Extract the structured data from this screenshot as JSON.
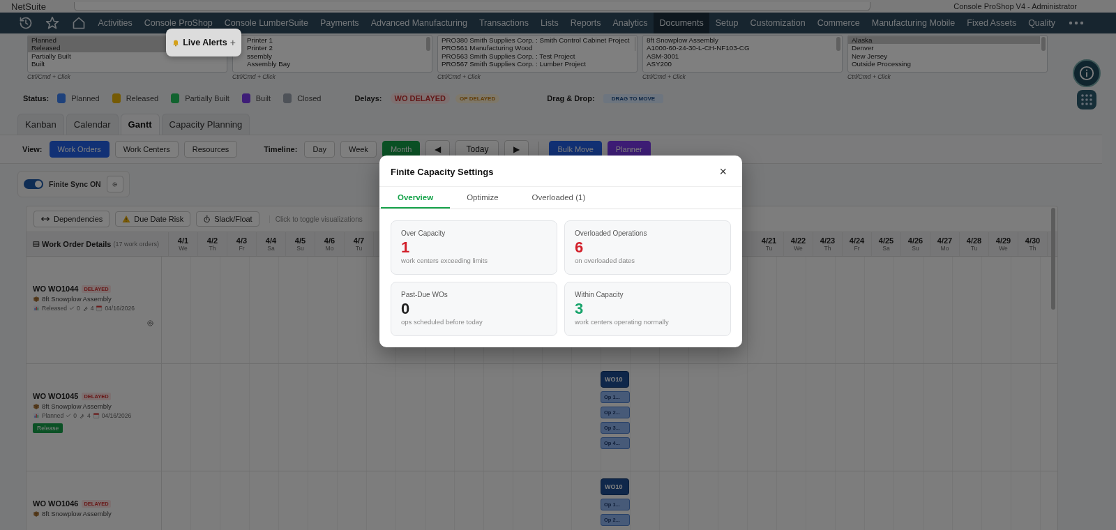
{
  "header": {
    "brand": "NetSuite",
    "user": "Console ProShop V4 - Administrator"
  },
  "nav": {
    "items": [
      {
        "label": "Activities",
        "selected": false
      },
      {
        "label": "Console ProShop",
        "selected": false
      },
      {
        "label": "Console LumberSuite",
        "selected": false
      },
      {
        "label": "Payments",
        "selected": false
      },
      {
        "label": "Advanced Manufacturing",
        "selected": false
      },
      {
        "label": "Transactions",
        "selected": false
      },
      {
        "label": "Lists",
        "selected": false
      },
      {
        "label": "Reports",
        "selected": false
      },
      {
        "label": "Analytics",
        "selected": false
      },
      {
        "label": "Documents",
        "selected": true
      },
      {
        "label": "Setup",
        "selected": false
      },
      {
        "label": "Customization",
        "selected": false
      },
      {
        "label": "Commerce",
        "selected": false
      },
      {
        "label": "Manufacturing Mobile",
        "selected": false
      },
      {
        "label": "Fixed Assets",
        "selected": false
      },
      {
        "label": "Quality",
        "selected": false
      }
    ]
  },
  "filters": [
    {
      "hint": "Ctrl/Cmd + Click",
      "options": [
        {
          "label": "Planned",
          "selected": true
        },
        {
          "label": "Released",
          "selected": true
        },
        {
          "label": "Partially Built",
          "selected": false
        },
        {
          "label": "Built",
          "selected": false
        }
      ]
    },
    {
      "hint": "Ctrl/Cmd + Click",
      "options": [
        {
          "label": "Printer 1",
          "selected": false
        },
        {
          "label": "Printer 2",
          "selected": false
        },
        {
          "label": "ssembly",
          "selected": false
        },
        {
          "label": "Assembly Bay",
          "selected": false
        }
      ]
    },
    {
      "hint": "Ctrl/Cmd + Click",
      "options": [
        {
          "label": "PRO380 Smith Supplies Corp. : Smith Control Cabinet Project",
          "selected": false
        },
        {
          "label": "PRO561 Manufacturing Wood",
          "selected": false
        },
        {
          "label": "PRO563 Smith Supplies Corp. : Test Project",
          "selected": false
        },
        {
          "label": "PRO567 Smith Supplies Corp. : Lumber Project",
          "selected": false
        }
      ]
    },
    {
      "hint": "Ctrl/Cmd + Click",
      "options": [
        {
          "label": "8ft Snowplow Assembly",
          "selected": false
        },
        {
          "label": "A1000-60-24-30-L-CH-NF103-CG",
          "selected": false
        },
        {
          "label": "ASM-3001",
          "selected": false
        },
        {
          "label": "ASY200",
          "selected": false
        }
      ]
    },
    {
      "hint": "Ctrl/Cmd + Click",
      "options": [
        {
          "label": "Alaska",
          "selected": true
        },
        {
          "label": "Denver",
          "selected": false
        },
        {
          "label": "New Jersey",
          "selected": false
        },
        {
          "label": "Outside Processing",
          "selected": false
        }
      ]
    }
  ],
  "legend": {
    "status_label": "Status:",
    "statuses": [
      {
        "label": "Planned",
        "color": "#1e417b"
      },
      {
        "label": "Released",
        "color": "#755a04"
      },
      {
        "label": "Partially Built",
        "color": "#11632f"
      },
      {
        "label": "Built",
        "color": "#3e1d77"
      },
      {
        "label": "Closed",
        "color": "#4e5258"
      }
    ],
    "delays_label": "Delays:",
    "delays": [
      {
        "label": "WO DELAYED",
        "kind": "wo"
      },
      {
        "label": "OP DELAYED",
        "kind": "op"
      }
    ],
    "drag_label": "Drag & Drop:",
    "drag_badge": "DRAG TO MOVE"
  },
  "tabs": [
    {
      "label": "Kanban",
      "selected": false
    },
    {
      "label": "Calendar",
      "selected": false
    },
    {
      "label": "Gantt",
      "selected": true
    },
    {
      "label": "Capacity Planning",
      "selected": false
    }
  ],
  "view": {
    "label": "View:",
    "options": [
      {
        "label": "Work Orders",
        "selected": true
      },
      {
        "label": "Work Centers",
        "selected": false
      },
      {
        "label": "Resources",
        "selected": false
      }
    ]
  },
  "timeline": {
    "label": "Timeline:",
    "options": [
      {
        "label": "Day",
        "selected": false
      },
      {
        "label": "Week",
        "selected": false
      },
      {
        "label": "Month",
        "selected": true
      }
    ],
    "prev": "◀",
    "today": "Today",
    "next": "▶"
  },
  "actions": [
    {
      "label": "Bulk Move",
      "kind": "bulk"
    },
    {
      "label": "Planner",
      "kind": "planner"
    }
  ],
  "finite_sync": {
    "label": "Finite Sync ON",
    "on": true
  },
  "gantt": {
    "tools": [
      {
        "label": "Dependencies",
        "kind": "dependencies"
      },
      {
        "label": "Due Date Risk",
        "kind": "risk"
      },
      {
        "label": "Slack/Float",
        "kind": "slack"
      }
    ],
    "hint": "Click to toggle visualizations",
    "details_title": "Work Order Details",
    "details_count": "(17 work orders)",
    "days_before": [
      {
        "date": "4/1",
        "weekday": "We"
      },
      {
        "date": "4/2",
        "weekday": "Th"
      },
      {
        "date": "4/3",
        "weekday": "Fr"
      },
      {
        "date": "4/4",
        "weekday": "Sa"
      },
      {
        "date": "4/5",
        "weekday": "Su"
      },
      {
        "date": "4/6",
        "weekday": "Mo"
      },
      {
        "date": "4/7",
        "weekday": "Tu"
      }
    ],
    "days_after": [
      {
        "date": "4/21",
        "weekday": "Tu"
      },
      {
        "date": "4/22",
        "weekday": "We"
      },
      {
        "date": "4/23",
        "weekday": "Th"
      },
      {
        "date": "4/24",
        "weekday": "Fr"
      },
      {
        "date": "4/25",
        "weekday": "Sa"
      },
      {
        "date": "4/26",
        "weekday": "Su"
      },
      {
        "date": "4/27",
        "weekday": "Mo"
      },
      {
        "date": "4/28",
        "weekday": "Tu"
      },
      {
        "date": "4/29",
        "weekday": "We"
      },
      {
        "date": "4/30",
        "weekday": "Th"
      }
    ],
    "rows": [
      {
        "title": "WO WO1044",
        "badge": "DELAYED",
        "product": "8ft Snowplow Assembly",
        "meta": {
          "status": "Released",
          "done": "0",
          "ops": "4",
          "due": "04/16/2026"
        },
        "action": {
          "kind": "gear"
        }
      },
      {
        "title": "WO WO1045",
        "badge": "DELAYED",
        "product": "8ft Snowplow Assembly",
        "meta": {
          "status": "Planned",
          "done": "0",
          "ops": "4",
          "due": "04/16/2026"
        },
        "action": {
          "kind": "button",
          "label": "Release"
        },
        "bar": "WO10",
        "ops": [
          "Op 1...",
          "Op 2...",
          "Op 3...",
          "Op 4..."
        ]
      },
      {
        "title": "WO WO1046",
        "badge": "DELAYED",
        "product": "8ft Snowplow Assembly",
        "bar": "WO10",
        "ops": [
          "Op 1...",
          "Op 2..."
        ]
      }
    ]
  },
  "live_alerts": {
    "label": "Live Alerts",
    "plus": "+"
  },
  "modal": {
    "title": "Finite Capacity Settings",
    "close": "×",
    "tabs": [
      {
        "label": "Overview",
        "selected": true
      },
      {
        "label": "Optimize",
        "selected": false
      },
      {
        "label": "Overloaded (1)",
        "selected": false
      }
    ],
    "cards": [
      {
        "label": "Over Capacity",
        "value": "1",
        "color": "#d21f2a",
        "caption": "work centers exceeding limits"
      },
      {
        "label": "Overloaded Operations",
        "value": "6",
        "color": "#d21f2a",
        "caption": "on overloaded dates"
      },
      {
        "label": "Past-Due WOs",
        "value": "0",
        "color": "#222222",
        "caption": "ops scheduled before today"
      },
      {
        "label": "Within Capacity",
        "value": "3",
        "color": "#16a36a",
        "caption": "work centers operating normally"
      }
    ]
  }
}
